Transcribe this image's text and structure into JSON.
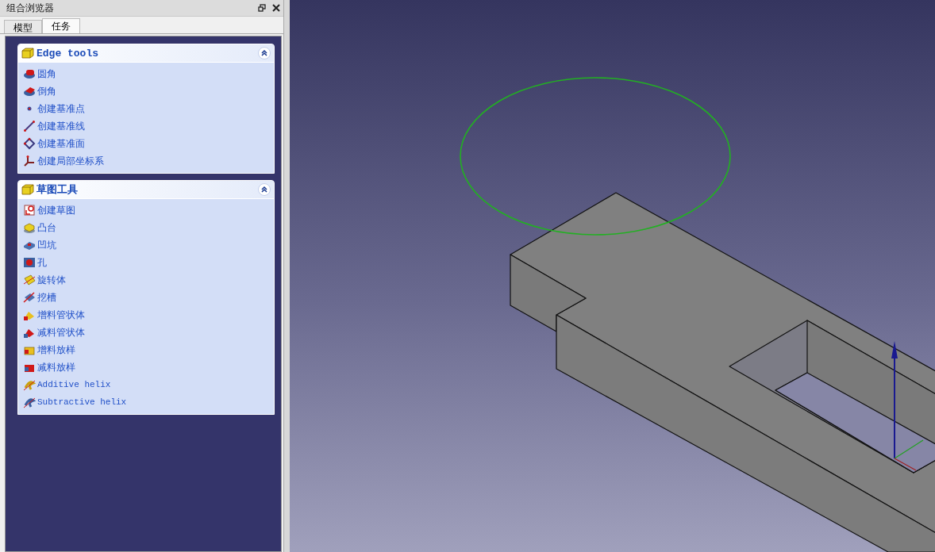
{
  "panel": {
    "title": "组合浏览器"
  },
  "tabs": [
    {
      "label": "模型",
      "selected": false
    },
    {
      "label": "任务",
      "selected": true
    }
  ],
  "task_boxes": [
    {
      "title": "Edge tools",
      "expanded": true,
      "items": [
        {
          "label": "圆角"
        },
        {
          "label": "倒角"
        },
        {
          "label": "创建基准点"
        },
        {
          "label": "创建基准线"
        },
        {
          "label": "创建基准面"
        },
        {
          "label": "创建局部坐标系"
        }
      ]
    },
    {
      "title": "草图工具",
      "expanded": true,
      "items": [
        {
          "label": "创建草图"
        },
        {
          "label": "凸台"
        },
        {
          "label": "凹坑"
        },
        {
          "label": "孔"
        },
        {
          "label": "旋转体"
        },
        {
          "label": "挖槽"
        },
        {
          "label": "增料管状体"
        },
        {
          "label": "减料管状体"
        },
        {
          "label": "增料放样"
        },
        {
          "label": "减料放样"
        },
        {
          "label": "Additive helix"
        },
        {
          "label": "Subtractive helix"
        }
      ]
    }
  ]
}
